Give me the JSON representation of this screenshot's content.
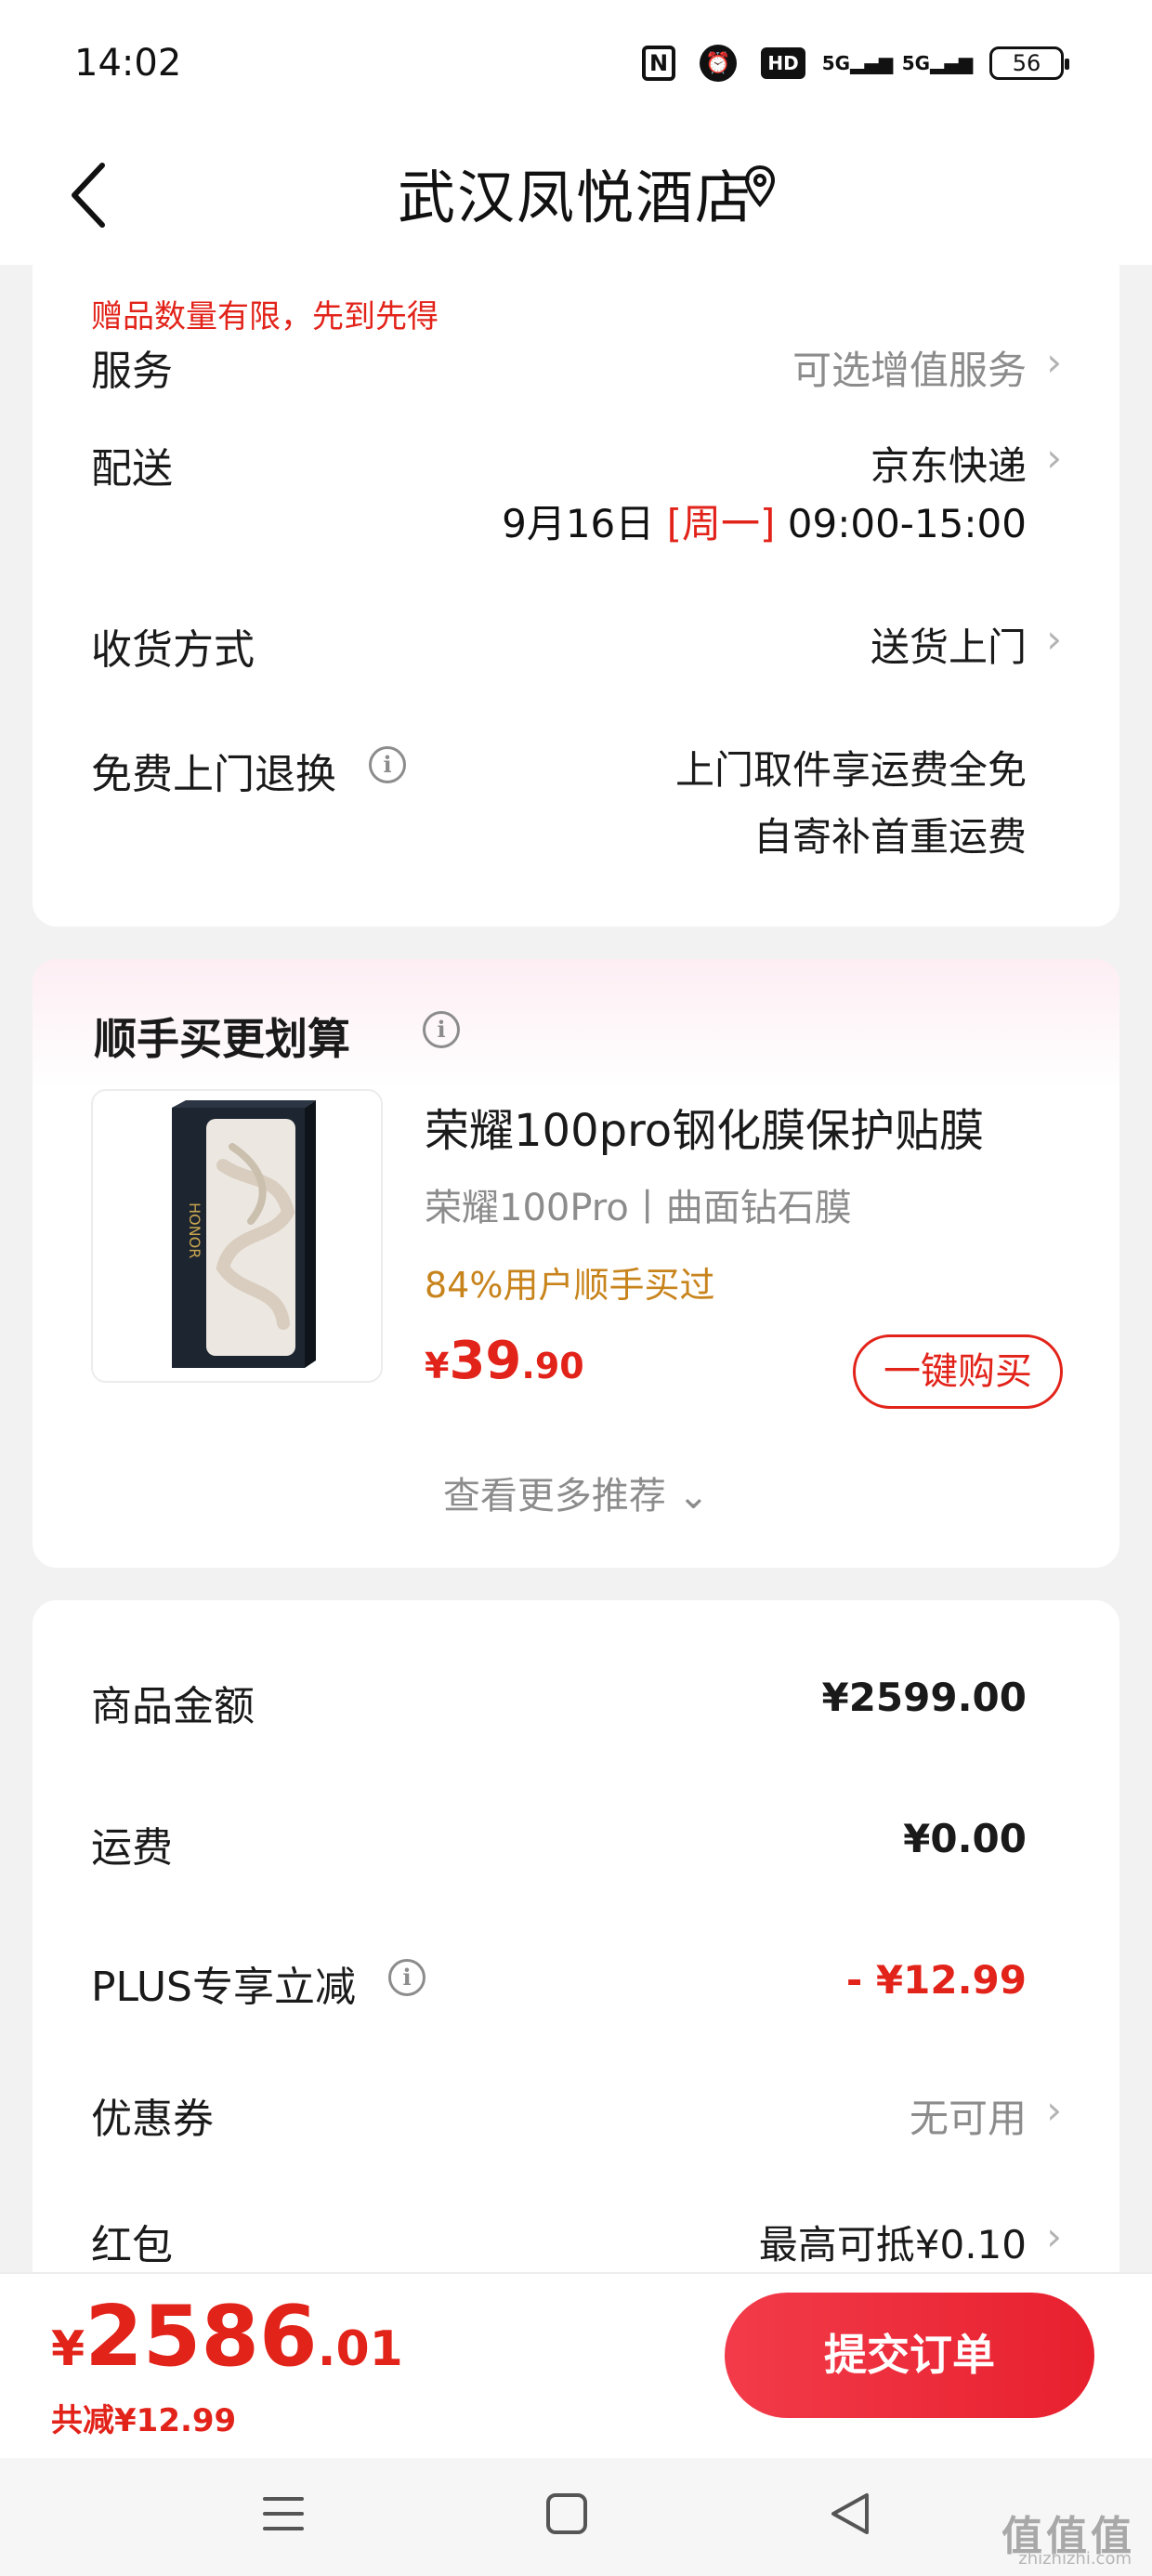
{
  "status_bar": {
    "time": "14:02",
    "icons": [
      "nfc-icon",
      "alarm-icon",
      "hd-icon",
      "signal-5g-icon",
      "signal-5g-icon",
      "battery-icon"
    ],
    "nfc": "N",
    "hd": "HD",
    "sig1": "5G",
    "sig2": "5G",
    "battery": "56"
  },
  "header": {
    "title": "武汉凤悦酒店"
  },
  "delivery_card": {
    "gift_note": "赠品数量有限，先到先得",
    "service_label": "服务",
    "service_value": "可选增值服务",
    "shipping_label": "配送",
    "shipping_value": "京东快递",
    "shipping_date": "9月16日",
    "shipping_weekday": "[周一]",
    "shipping_time": "09:00-15:00",
    "receive_label": "收货方式",
    "receive_value": "送货上门",
    "return_label": "免费上门退换",
    "return_value_1": "上门取件享运费全免",
    "return_value_2": "自寄补首重运费"
  },
  "recommend_card": {
    "title": "顺手买更划算",
    "product_name": "荣耀100pro钢化膜保护贴膜",
    "product_spec": "荣耀100Pro丨曲面钻石膜",
    "product_bought": "84%用户顺手买过",
    "price_currency": "¥",
    "price_int": "39",
    "price_dec": ".90",
    "buy_label": "一键购买",
    "more_label": "查看更多推荐"
  },
  "price_card": {
    "goods_label": "商品金额",
    "goods_value": "¥2599.00",
    "freight_label": "运费",
    "freight_value": "¥0.00",
    "plus_label": "PLUS专享立减",
    "plus_value": "- ¥12.99",
    "coupon_label": "优惠券",
    "coupon_value": "无可用",
    "redpacket_label": "红包",
    "redpacket_value": "最高可抵¥0.10"
  },
  "bottom_bar": {
    "total_currency": "¥",
    "total_int": "2586",
    "total_dec": ".01",
    "saved": "共减¥12.99",
    "submit_label": "提交订单"
  },
  "nav": {
    "watermark": "值值值",
    "watermark_sub": "zhizhizhi.com"
  },
  "colors": {
    "accent_red": "#e2231a",
    "bought_orange": "#c8841c",
    "grey_text": "#8c8c8c"
  }
}
